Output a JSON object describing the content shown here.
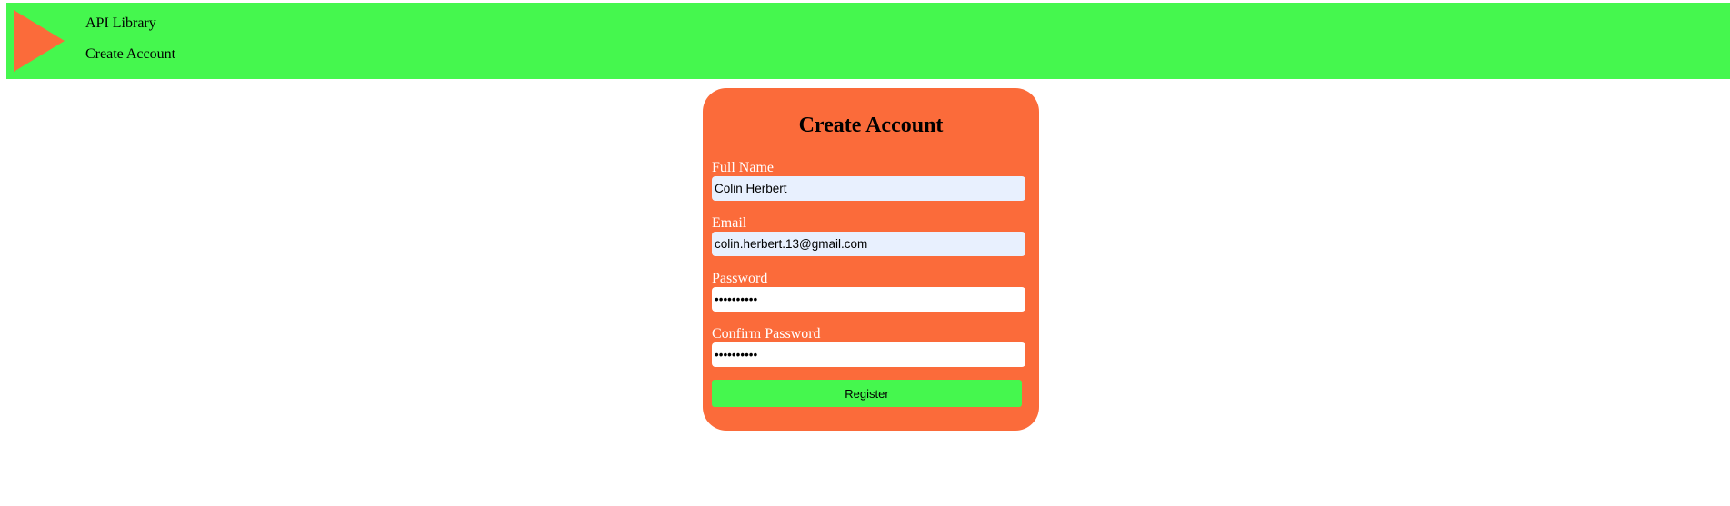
{
  "nav": {
    "logo_icon": "play-triangle-icon",
    "links": [
      {
        "label": "API Library"
      },
      {
        "label": "Create Account"
      }
    ]
  },
  "form": {
    "title": "Create Account",
    "fields": [
      {
        "label": "Full Name",
        "value": "Colin Herbert",
        "type": "text"
      },
      {
        "label": "Email",
        "value": "colin.herbert.13@gmail.com",
        "type": "email"
      },
      {
        "label": "Password",
        "value": "••••••••••",
        "type": "password"
      },
      {
        "label": "Confirm Password",
        "value": "••••••••••",
        "type": "password"
      }
    ],
    "submit_label": "Register"
  },
  "colors": {
    "navbar_bg": "#45f74e",
    "card_bg": "#fb6b3a",
    "button_bg": "#45f74e",
    "label_text": "#ffffff",
    "autofill_bg": "#e8f0fe"
  }
}
